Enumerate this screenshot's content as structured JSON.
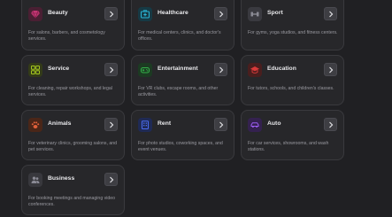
{
  "cards": [
    {
      "title": "Beauty",
      "description": "For salons, barbers, and cosmetology services.",
      "icon": "gem-icon",
      "color": "#b4306b",
      "bg": "#4a1f33"
    },
    {
      "title": "Healthcare",
      "description": "For medical centers, clinics, and doctor's offices.",
      "icon": "medkit-icon",
      "color": "#2bb6d6",
      "bg": "#163a45"
    },
    {
      "title": "Sport",
      "description": "For gyms, yoga studios, and fitness centers.",
      "icon": "dumbbell-icon",
      "color": "#8a8a94",
      "bg": "#3a3a40"
    },
    {
      "title": "Service",
      "description": "For cleaning, repair workshops, and legal services.",
      "icon": "grid-icon",
      "color": "#a3c61e",
      "bg": "#333b18"
    },
    {
      "title": "Entertainment",
      "description": "For VR clubs, escape rooms, and other activities.",
      "icon": "gamepad-icon",
      "color": "#34b24a",
      "bg": "#1c3b22"
    },
    {
      "title": "Education",
      "description": "For tutors, schools, and children's classes.",
      "icon": "graduation-icon",
      "color": "#d93a3a",
      "bg": "#4a1e1e"
    },
    {
      "title": "Animals",
      "description": "For veterinary clinics, grooming salons, and pet services.",
      "icon": "paw-icon",
      "color": "#e0603a",
      "bg": "#4a2618"
    },
    {
      "title": "Rent",
      "description": "For photo studios, coworking spaces, and event venues.",
      "icon": "building-icon",
      "color": "#4a6cf0",
      "bg": "#1f2a55"
    },
    {
      "title": "Auto",
      "description": "For car services, showrooms, and wash stations.",
      "icon": "car-icon",
      "color": "#9b5cf0",
      "bg": "#34214f"
    },
    {
      "title": "Business",
      "description": "For booking meetings and managing video conferences.",
      "icon": "users-icon",
      "color": "#8a8a94",
      "bg": "#38383d"
    }
  ]
}
